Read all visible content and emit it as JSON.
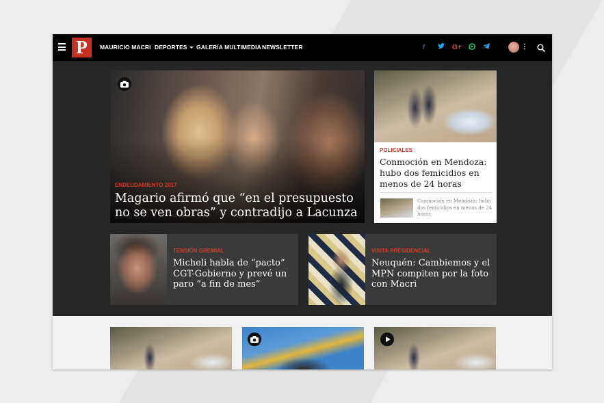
{
  "nav": {
    "logo_letter": "P",
    "items": [
      {
        "label": "MAURICIO MACRI"
      },
      {
        "label": "DEPORTES",
        "has_dropdown": true
      },
      {
        "label": "GALERÍA MULTIMEDIA"
      },
      {
        "label": "NEWSLETTER"
      }
    ],
    "social": [
      {
        "name": "facebook-icon",
        "glyph": "f",
        "color": "#3b5998"
      },
      {
        "name": "twitter-icon",
        "glyph": "t",
        "color": "#1da1f2"
      },
      {
        "name": "google-plus-icon",
        "glyph": "G+",
        "color": "#dd4b39"
      },
      {
        "name": "whatsapp-icon",
        "glyph": "w",
        "color": "#25d366"
      },
      {
        "name": "telegram-icon",
        "glyph": "➤",
        "color": "#2ca5e0"
      }
    ]
  },
  "hero": {
    "category": "ENDEUDAMIENTO 2017",
    "title": "Magario afirmó que “en el presupuesto no se ven obras” y contradijo a Lacunza"
  },
  "side_card": {
    "category": "POLICIALES",
    "title": "Conmoción en Mendoza: hubo dos femicidios en menos de 24 horas",
    "related": "Conmoción en Mendoza: hubo dos femicidios en menos de 24 horas"
  },
  "mini_cards": [
    {
      "category": "TENSIÓN GREMIAL",
      "title": "Micheli habla de “pacto” CGT-Gobierno y prevé un paro “a fin de mes”"
    },
    {
      "category": "VISITA PRESIDENCIAL",
      "title": "Neuquén: Cambiemos y el MPN compiten por la foto con Macri"
    }
  ],
  "colors": {
    "accent": "#d1372b",
    "nav_bg": "#000000",
    "dark_bg": "#262626",
    "card_bg": "#3a3a3a"
  }
}
